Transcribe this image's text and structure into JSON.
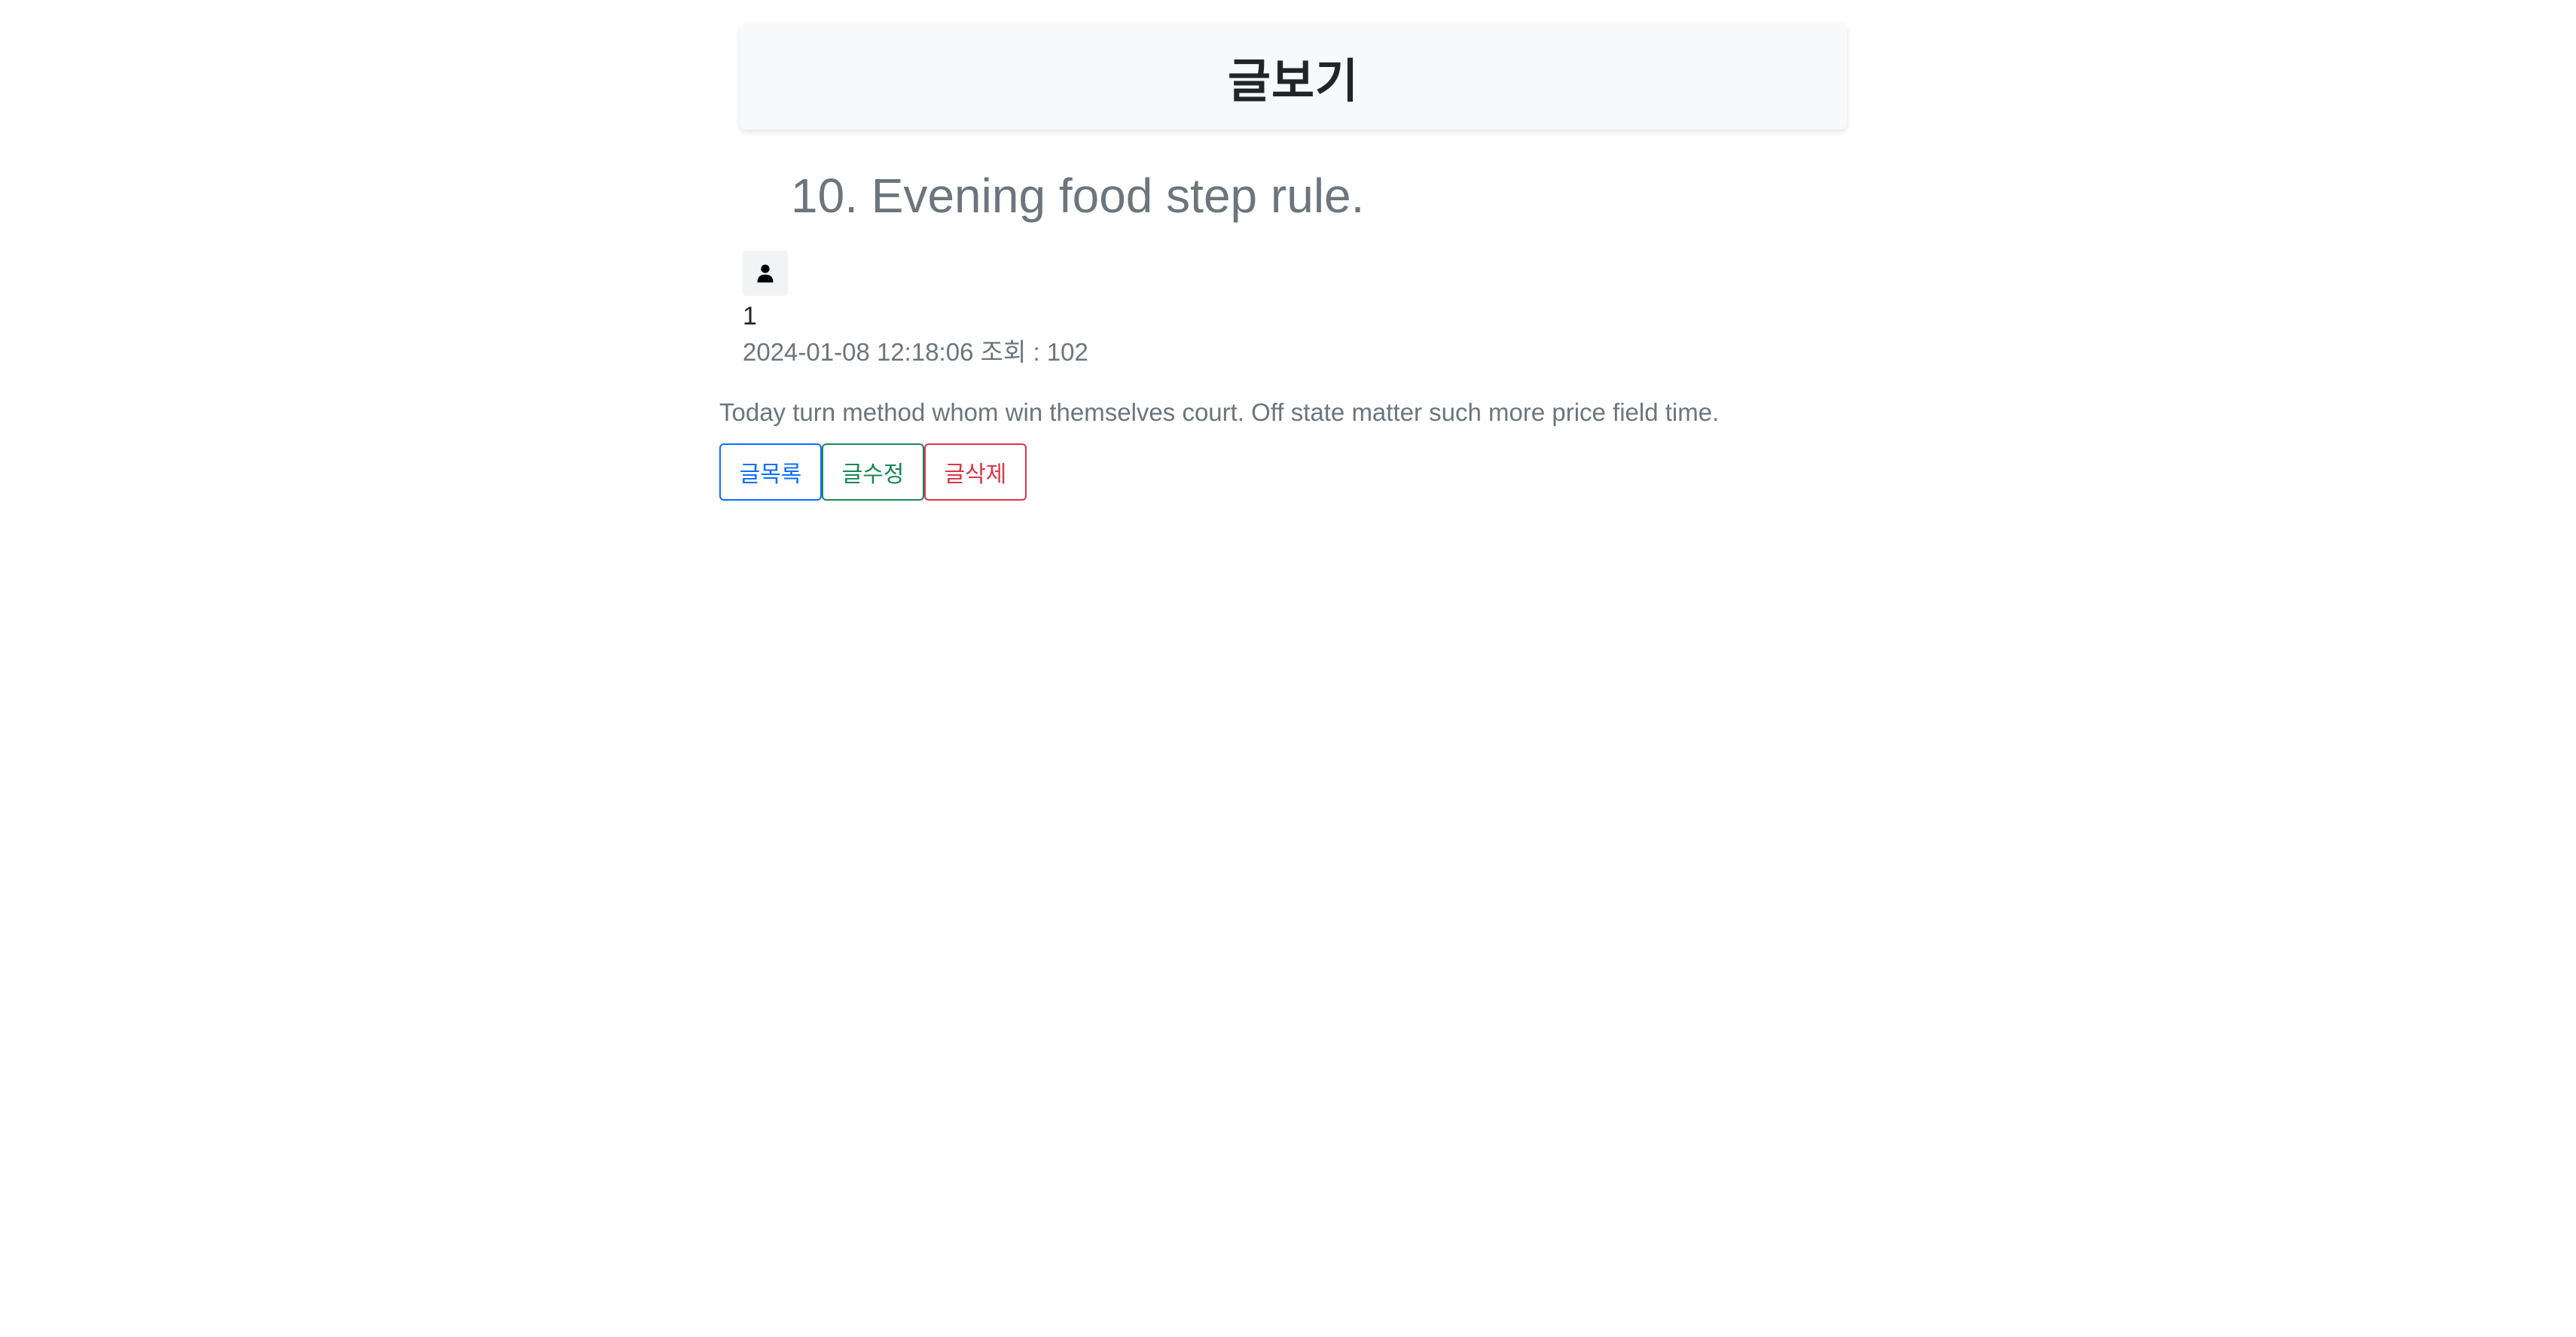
{
  "header": {
    "title": "글보기"
  },
  "post": {
    "number_title": "10. Evening food step rule.",
    "author": "1",
    "meta": "2024-01-08 12:18:06 조회 : 102",
    "content": "Today turn method whom win themselves court. Off state matter such more price field time."
  },
  "actions": {
    "list_label": "글목록",
    "edit_label": "글수정",
    "delete_label": "글삭제"
  },
  "colors": {
    "primary": "#0d6efd",
    "success": "#198754",
    "danger": "#dc3545",
    "muted": "#6c757d"
  },
  "icons": {
    "avatar": "person-icon"
  }
}
